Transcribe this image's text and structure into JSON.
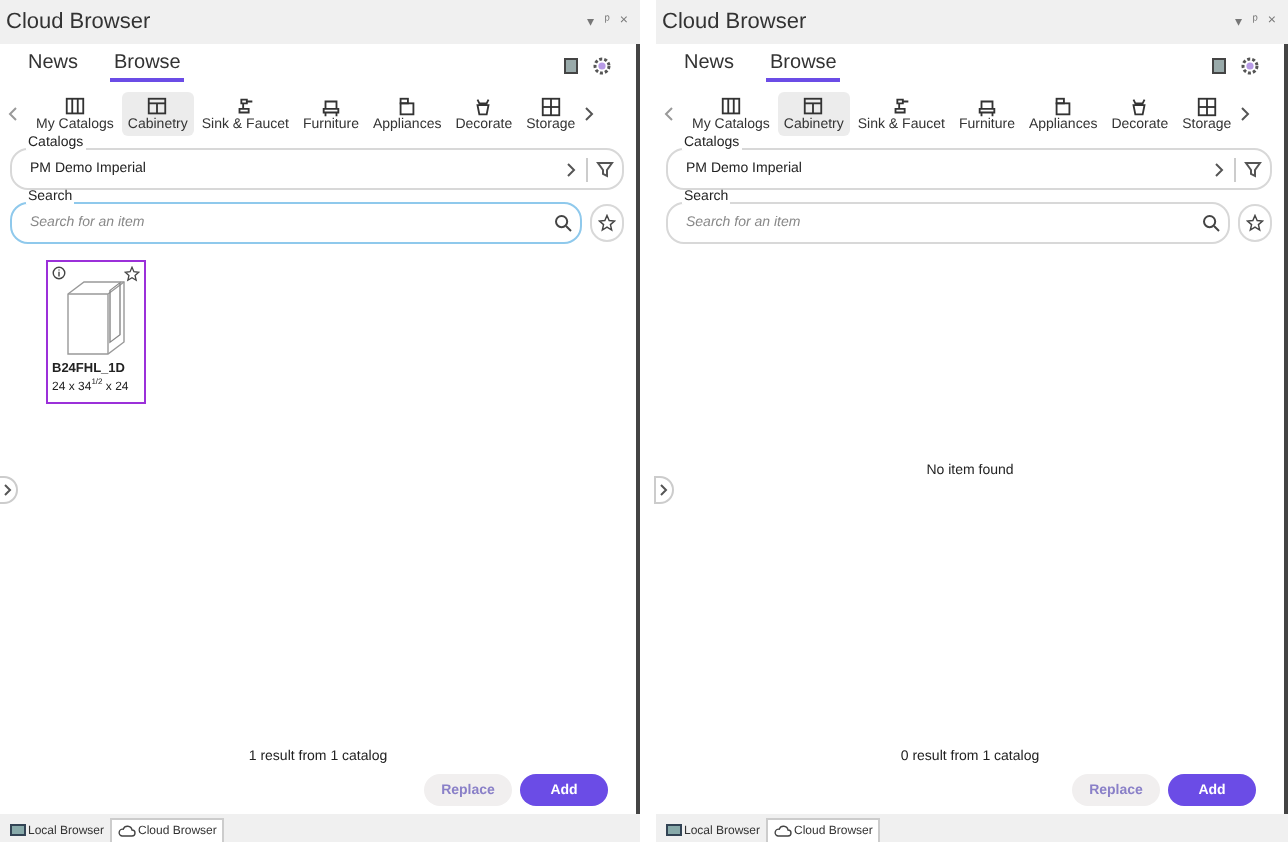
{
  "panels": [
    {
      "title": "Cloud Browser",
      "window_controls": [
        "▾",
        "ᵖ",
        "×"
      ],
      "tabs": [
        {
          "label": "News",
          "selected": false
        },
        {
          "label": "Browse",
          "selected": true
        }
      ],
      "categories": [
        {
          "label": "My Catalogs",
          "selected": false
        },
        {
          "label": "Cabinetry",
          "selected": true
        },
        {
          "label": "Sink & Faucet",
          "selected": false
        },
        {
          "label": "Furniture",
          "selected": false
        },
        {
          "label": "Appliances",
          "selected": false
        },
        {
          "label": "Decorate",
          "selected": false
        },
        {
          "label": "Storage",
          "selected": false
        }
      ],
      "catalogs": {
        "label": "Catalogs",
        "value": "PM Demo Imperial"
      },
      "search": {
        "label": "Search",
        "placeholder": "Search for an item",
        "focused": true
      },
      "items": [
        {
          "name": "B24FHL_1D",
          "size": "24 x 34$^{1/2}$ x 24",
          "selected": true
        }
      ],
      "result_text": "1 result from 1 catalog",
      "buttons": [
        {
          "label": "Replace",
          "disabled": true
        },
        {
          "label": "Add",
          "disabled": false
        }
      ],
      "bottom_tabs": [
        {
          "label": "Local Browser",
          "selected": false
        },
        {
          "label": "Cloud Browser",
          "selected": true
        }
      ]
    },
    {
      "title": "Cloud Browser",
      "window_controls": [
        "▾",
        "ᵖ",
        "×"
      ],
      "tabs": [
        {
          "label": "News",
          "selected": false
        },
        {
          "label": "Browse",
          "selected": true
        }
      ],
      "categories": [
        {
          "label": "My Catalogs",
          "selected": false
        },
        {
          "label": "Cabinetry",
          "selected": true
        },
        {
          "label": "Sink & Faucet",
          "selected": false
        },
        {
          "label": "Furniture",
          "selected": false
        },
        {
          "label": "Appliances",
          "selected": false
        },
        {
          "label": "Decorate",
          "selected": false
        },
        {
          "label": "Storage",
          "selected": false
        }
      ],
      "catalogs": {
        "label": "Catalogs",
        "value": "PM Demo Imperial"
      },
      "search": {
        "label": "Search",
        "placeholder": "Search for an item",
        "focused": false
      },
      "empty_message": "No item found",
      "result_text": "0 result from 1 catalog",
      "buttons": [
        {
          "label": "Replace",
          "disabled": true
        },
        {
          "label": "Add",
          "disabled": false
        }
      ],
      "bottom_tabs": [
        {
          "label": "Local Browser",
          "selected": false
        },
        {
          "label": "Cloud Browser",
          "selected": true
        }
      ]
    }
  ]
}
